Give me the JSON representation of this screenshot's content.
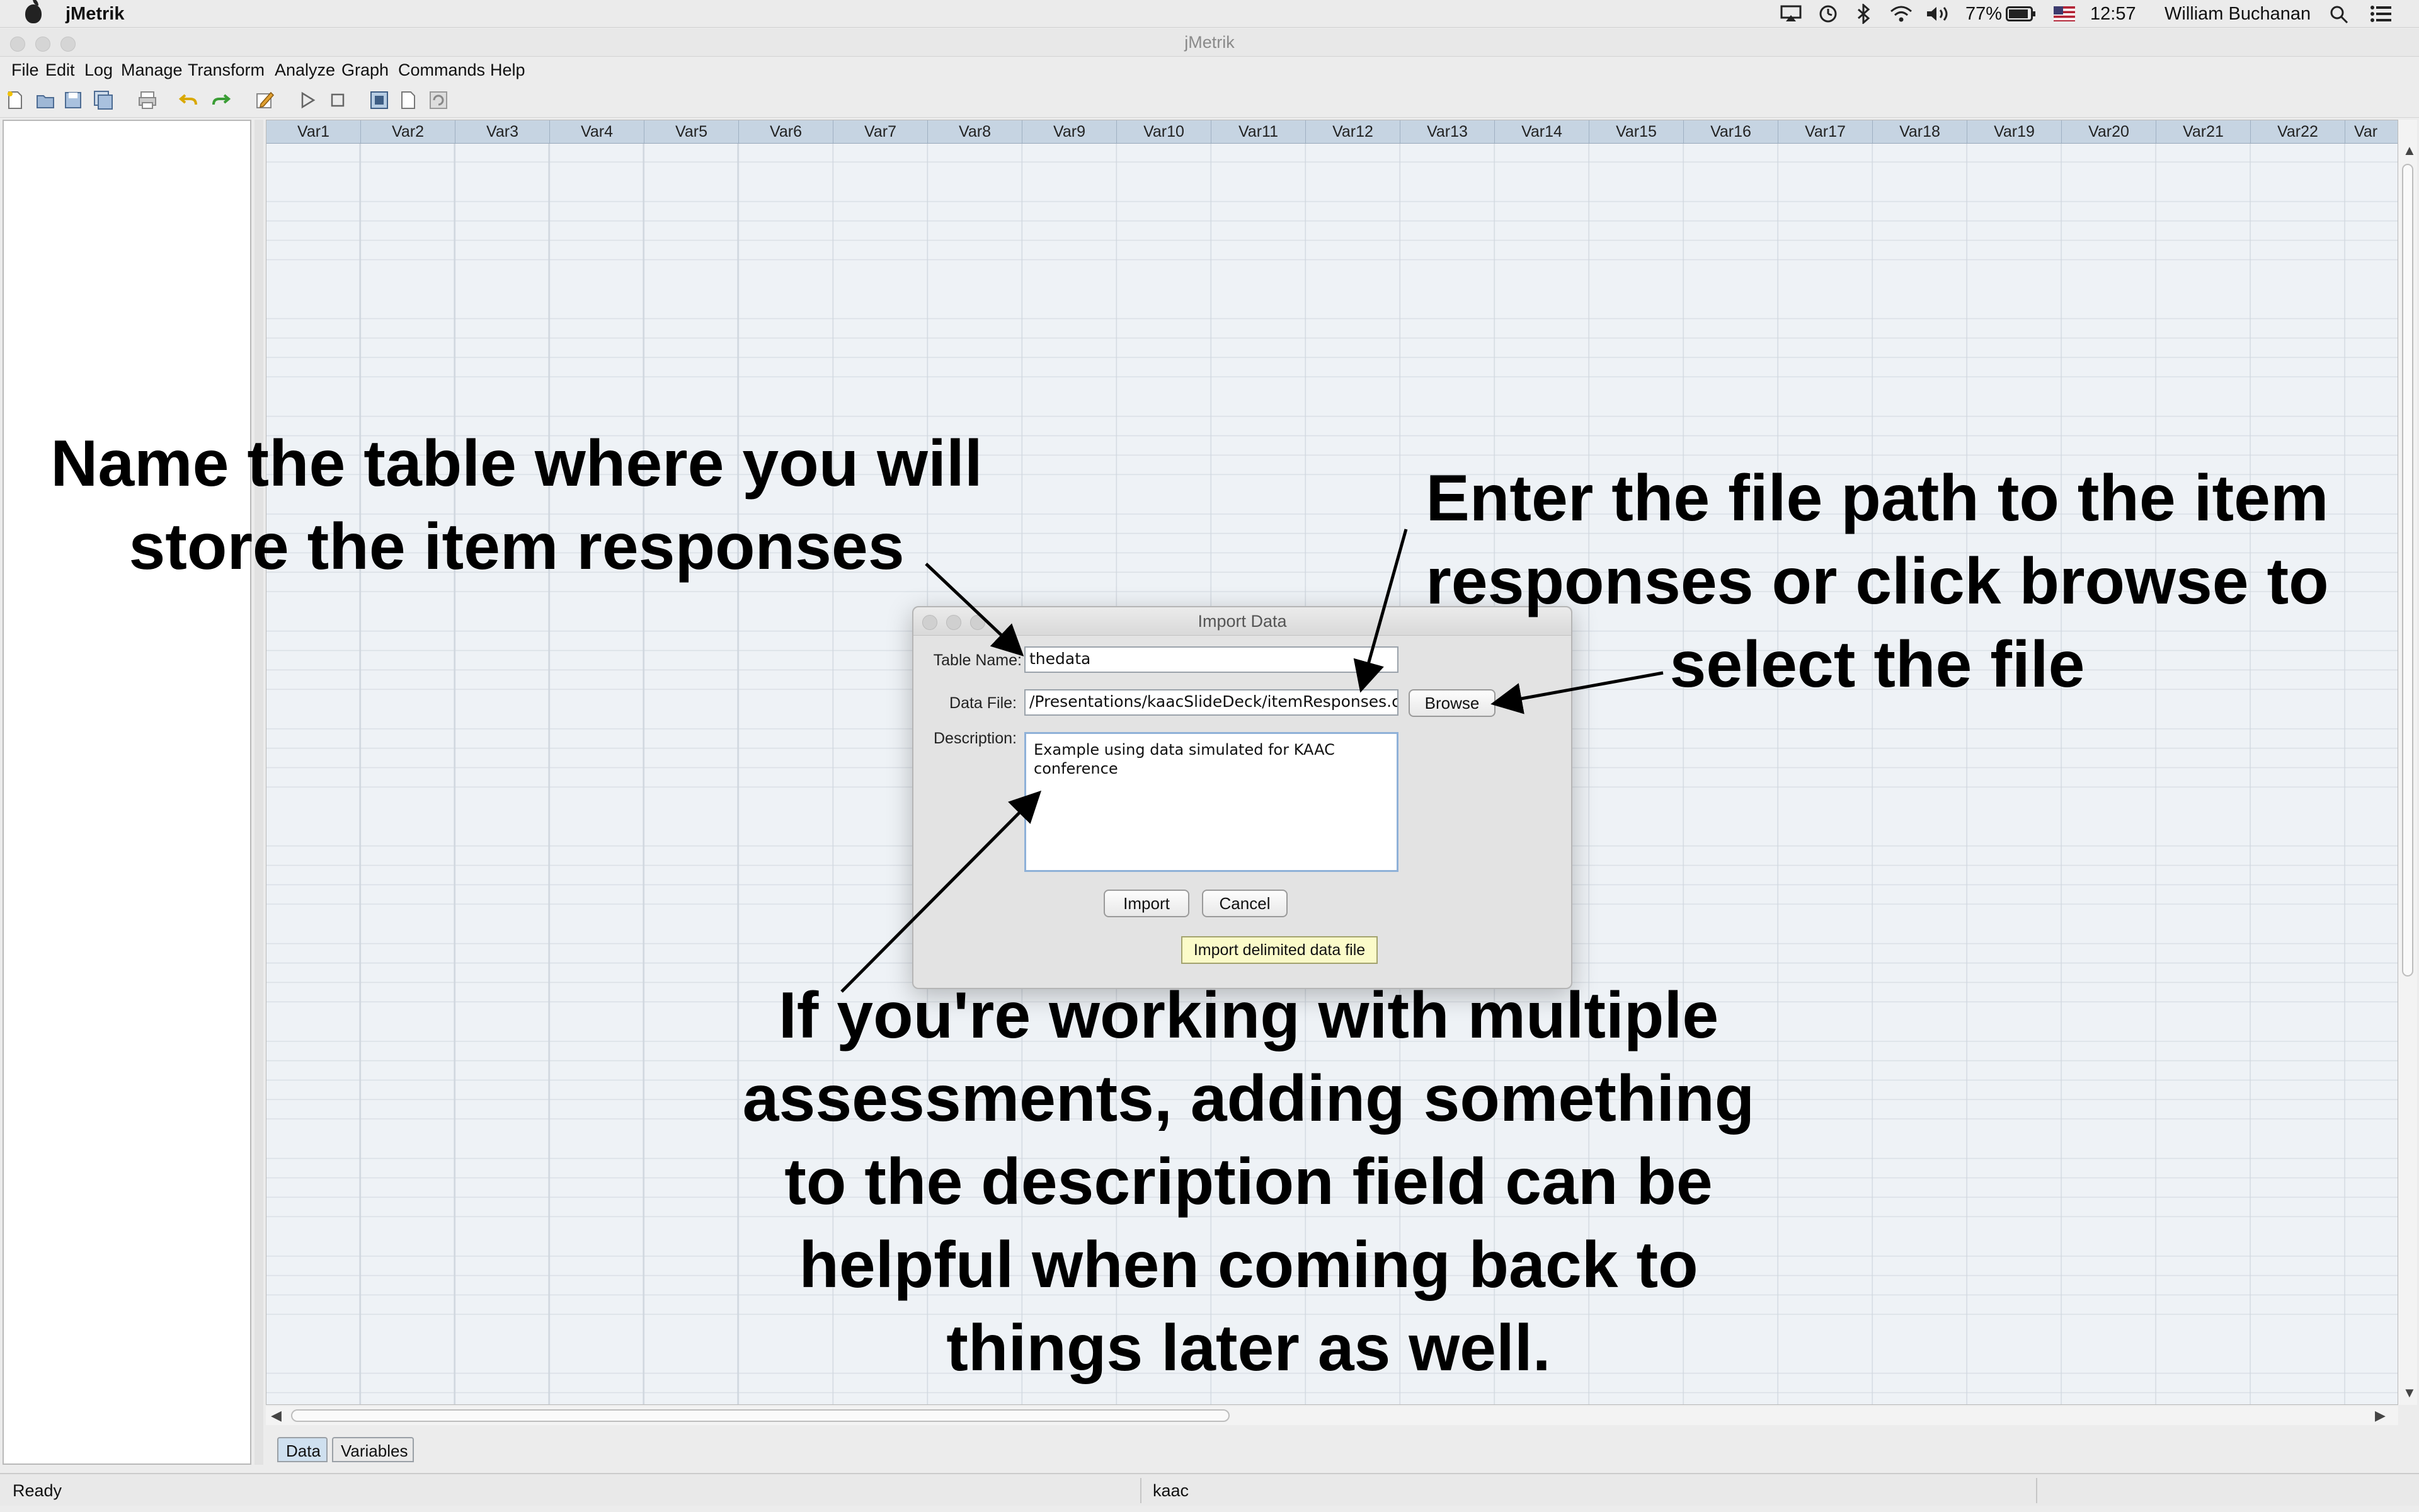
{
  "menubar": {
    "app_name": "jMetrik",
    "battery": "77%",
    "time": "12:57",
    "user": "William Buchanan"
  },
  "window": {
    "title": "jMetrik"
  },
  "app_menu": {
    "items": [
      "File",
      "Edit",
      "Log",
      "Manage",
      "Transform",
      "Analyze",
      "Graph",
      "Commands",
      "Help"
    ]
  },
  "grid": {
    "columns": [
      "Var1",
      "Var2",
      "Var3",
      "Var4",
      "Var5",
      "Var6",
      "Var7",
      "Var8",
      "Var9",
      "Var10",
      "Var11",
      "Var12",
      "Var13",
      "Var14",
      "Var15",
      "Var16",
      "Var17",
      "Var18",
      "Var19",
      "Var20",
      "Var21",
      "Var22",
      "Var"
    ]
  },
  "tabs": {
    "data": "Data",
    "variables": "Variables"
  },
  "status": {
    "left": "Ready",
    "middle": "kaac"
  },
  "dialog": {
    "title": "Import Data",
    "table_name_label": "Table Name:",
    "table_name_value": "thedata",
    "data_file_label": "Data File:",
    "data_file_value": "/Presentations/kaacSlideDeck/itemResponses.csv",
    "browse_label": "Browse",
    "description_label": "Description:",
    "description_value": "Example using data simulated for KAAC\nconference",
    "import_label": "Import",
    "cancel_label": "Cancel",
    "tooltip": "Import delimited data file"
  },
  "annotations": {
    "table_name": [
      "Name the table where you will",
      "store the item responses"
    ],
    "file_path": [
      "Enter the file path to the item",
      "responses or click browse to",
      "select the file"
    ],
    "description": [
      "If you're working with multiple",
      "assessments, adding something",
      "to the description field can be",
      "helpful when coming back to",
      "things later as well."
    ]
  },
  "colors": {
    "grid_header": "#c6d4e2",
    "grid_bg": "#eef2f6",
    "tooltip_bg": "#fbfbc9",
    "description_focus": "#8fb1d8"
  }
}
